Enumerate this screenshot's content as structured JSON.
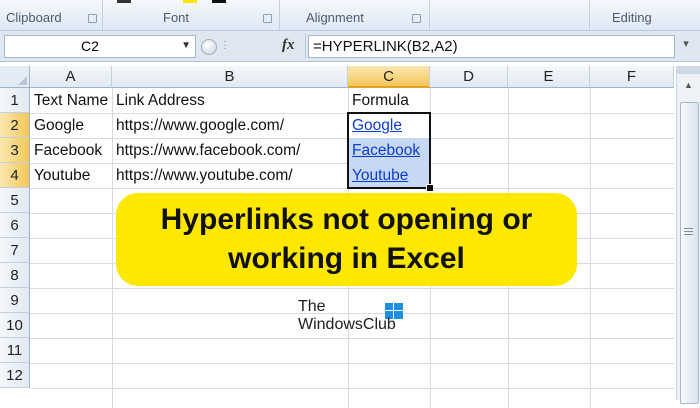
{
  "ribbon": {
    "groups": [
      {
        "label": "Clipboard"
      },
      {
        "label": "Font"
      },
      {
        "label": "Alignment"
      },
      {
        "label": "Editing"
      }
    ]
  },
  "formula_bar": {
    "name_box": "C2",
    "fx_label": "fx",
    "formula": "=HYPERLINK(B2,A2)"
  },
  "sheet": {
    "columns": [
      "A",
      "B",
      "C",
      "D",
      "E",
      "F"
    ],
    "rows": [
      "1",
      "2",
      "3",
      "4",
      "5",
      "6",
      "7",
      "8",
      "9",
      "10",
      "11",
      "12"
    ],
    "selected_column": "C",
    "selected_rows": [
      "2",
      "3",
      "4"
    ],
    "cells": {
      "A1": "Text Name",
      "B1": "Link Address",
      "C1": "Formula",
      "A2": "Google",
      "B2": "https://www.google.com/",
      "C2": "Google",
      "A3": "Facebook",
      "B3": "https://www.facebook.com/",
      "C3": "Facebook",
      "A4": "Youtube",
      "B4": "https://www.youtube.com/",
      "C4": "Youtube"
    }
  },
  "overlay": {
    "title_line1": "Hyperlinks not opening or",
    "title_line2": "working in Excel",
    "accent_color": "#ffe800",
    "logo_line1": "The",
    "logo_line2": "WindowsClub"
  }
}
